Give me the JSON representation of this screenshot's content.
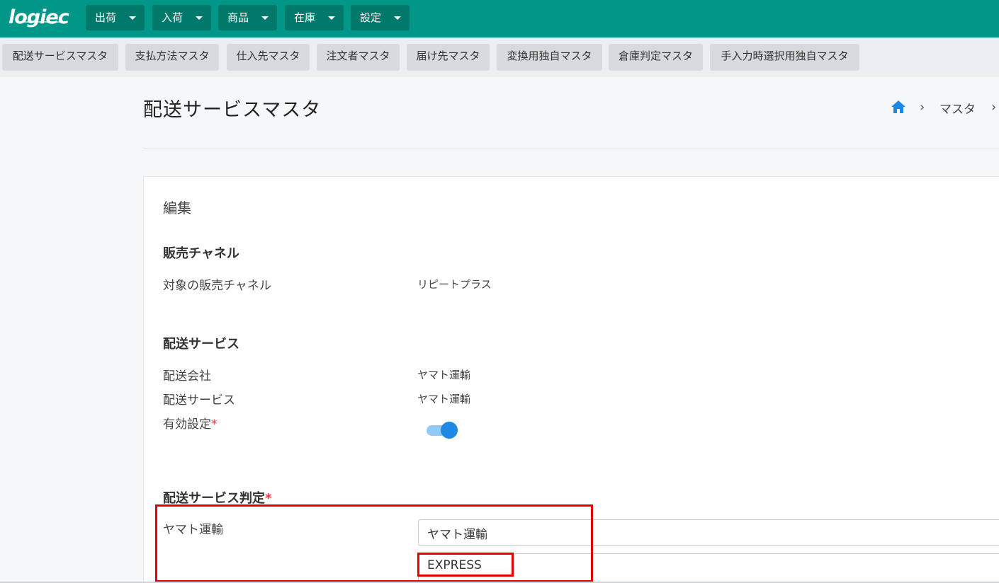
{
  "app": {
    "logo": "logiec"
  },
  "top_nav": [
    {
      "label": "出荷"
    },
    {
      "label": "入荷"
    },
    {
      "label": "商品"
    },
    {
      "label": "在庫"
    },
    {
      "label": "設定"
    }
  ],
  "sub_nav": [
    {
      "label": "配送サービスマスタ"
    },
    {
      "label": "支払方法マスタ"
    },
    {
      "label": "仕入先マスタ"
    },
    {
      "label": "注文者マスタ"
    },
    {
      "label": "届け先マスタ"
    },
    {
      "label": "変換用独自マスタ"
    },
    {
      "label": "倉庫判定マスタ"
    },
    {
      "label": "手入力時選択用独自マスタ"
    }
  ],
  "page": {
    "title": "配送サービスマスタ",
    "breadcrumb": {
      "item1": "マスタ"
    }
  },
  "card": {
    "title": "編集",
    "sales_channel": {
      "heading": "販売チャネル",
      "target_label": "対象の販売チャネル",
      "target_value": "リピートプラス"
    },
    "delivery_service": {
      "heading": "配送サービス",
      "company_label": "配送会社",
      "company_value": "ヤマト運輸",
      "service_label": "配送サービス",
      "service_value": "ヤマト運輸",
      "enabled_label": "有効設定",
      "required_mark": "*",
      "enabled": true
    },
    "judgement": {
      "heading": "配送サービス判定",
      "required_mark": "*",
      "row_label": "ヤマト運輸",
      "input1_value": "ヤマト運輸",
      "input2_value": "EXPRESS"
    }
  },
  "colors": {
    "topbar": "#009688",
    "nav_button": "#00796b",
    "toggle_on": "#1e88e5",
    "highlight": "#e00000"
  }
}
